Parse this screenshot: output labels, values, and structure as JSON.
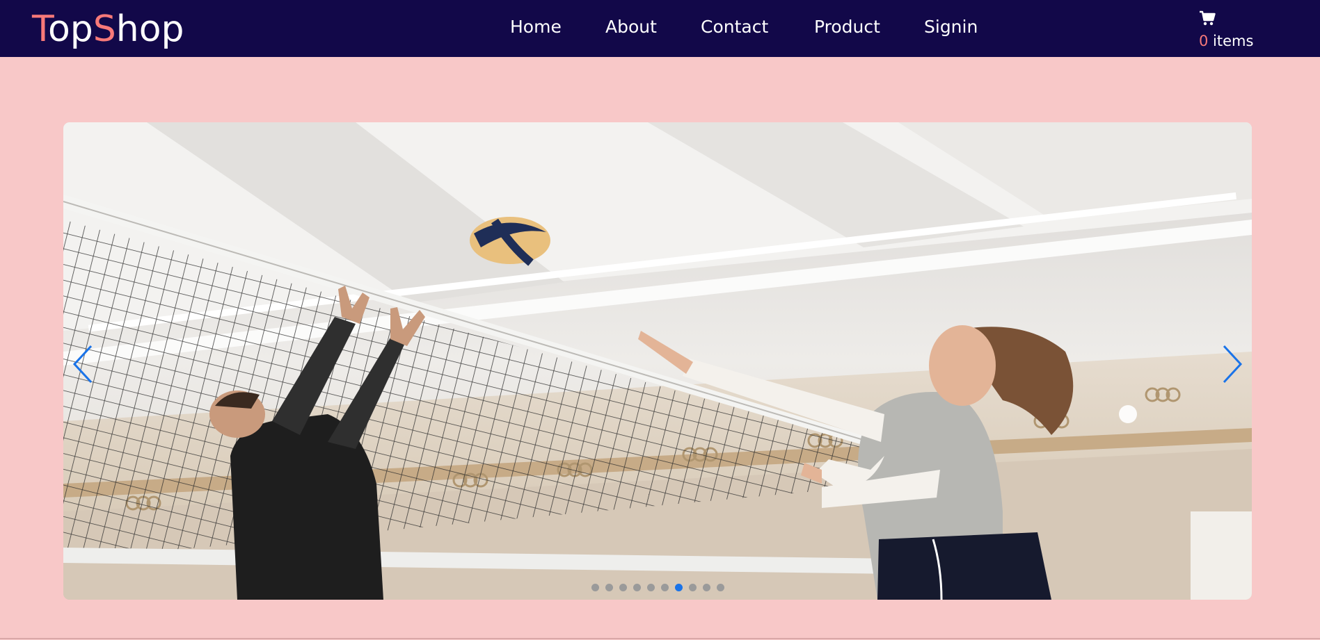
{
  "brand": {
    "letters": [
      {
        "text": "T",
        "accent": true
      },
      {
        "text": "op",
        "accent": false
      },
      {
        "text": "S",
        "accent": true
      },
      {
        "text": "hop",
        "accent": false
      }
    ]
  },
  "nav": {
    "items": [
      {
        "label": "Home"
      },
      {
        "label": "About"
      },
      {
        "label": "Contact"
      },
      {
        "label": "Product"
      },
      {
        "label": "Signin"
      }
    ]
  },
  "cart": {
    "icon": "cart-icon",
    "count": "0",
    "suffix": " items"
  },
  "carousel": {
    "slide_count": 10,
    "active_index": 6,
    "prev_icon": "chevron-left-icon",
    "next_icon": "chevron-right-icon"
  },
  "colors": {
    "navbar": "#120849",
    "page_background": "#f8c8c8",
    "accent": "#f87979",
    "indicator_active": "#1a73e8",
    "indicator_inactive": "#9a9a9a"
  }
}
